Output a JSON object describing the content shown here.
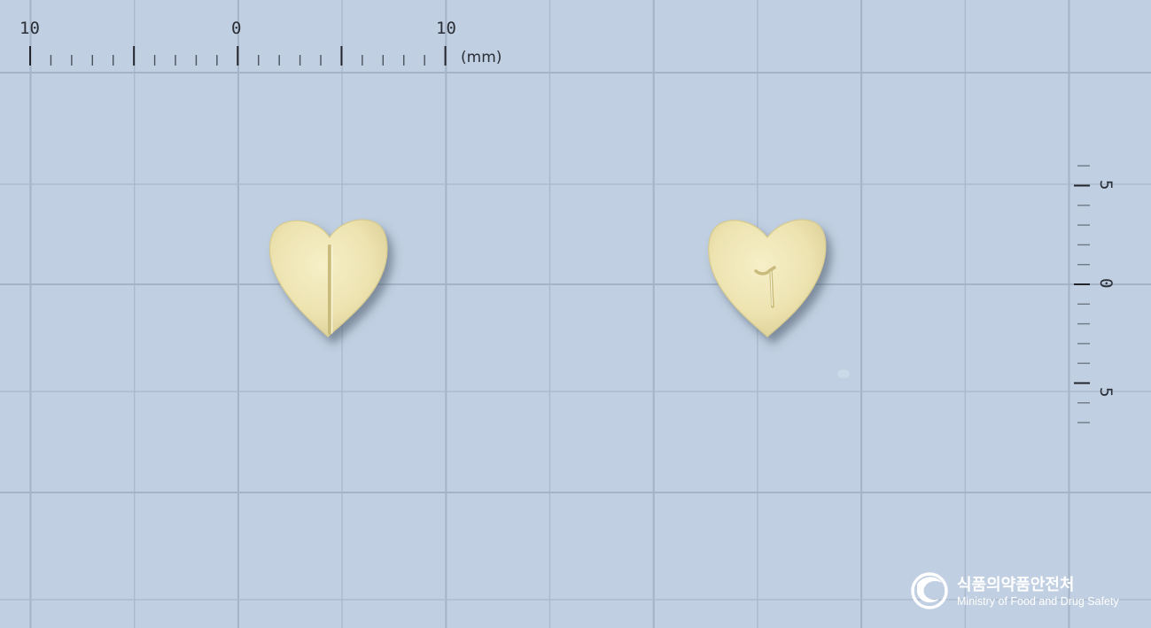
{
  "scene": {
    "background_color": "#c0cfe1",
    "grid_color": "#a9b8cb",
    "subject": "Two sides of a pale-yellow heart-shaped tablet photographed on a millimetre grid",
    "tablet_color": "#efe6b4"
  },
  "ruler_top": {
    "labels": [
      "10",
      "0",
      "10"
    ],
    "unit": "(mm)"
  },
  "ruler_right": {
    "labels": [
      "5",
      "0",
      "5"
    ]
  },
  "tablets": [
    {
      "side": "front",
      "marking": "score-line"
    },
    {
      "side": "back",
      "marking": "٢"
    }
  ],
  "logo": {
    "name_korean": "식품의약품안전처",
    "name_english": "Ministry of Food and Drug Safety",
    "icon": "mfds-emblem-icon"
  }
}
